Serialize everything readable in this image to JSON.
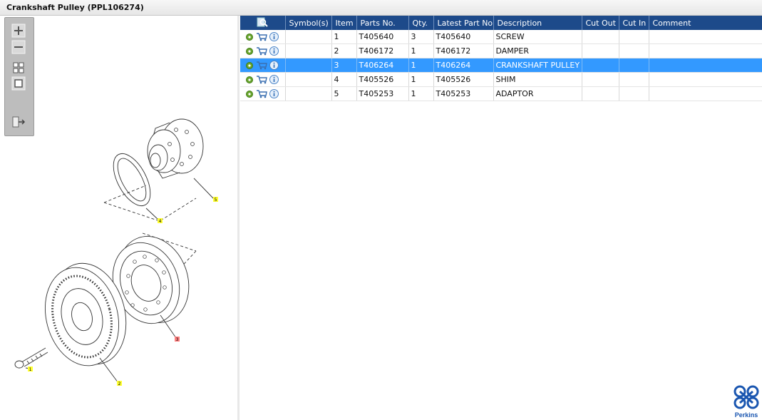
{
  "window": {
    "title": "Crankshaft Pulley (PPL106274)"
  },
  "toolbar": {
    "buttons": [
      {
        "name": "zoom-in-button",
        "icon": "zoom-in-icon"
      },
      {
        "name": "zoom-out-button",
        "icon": "zoom-out-icon"
      },
      {
        "name": "fit-all-button",
        "icon": "fit-all-icon"
      },
      {
        "name": "fit-window-button",
        "icon": "fit-window-icon"
      },
      {
        "name": "export-button",
        "icon": "export-arrow-icon"
      }
    ]
  },
  "diagram": {
    "callouts": [
      "1",
      "2",
      "3",
      "4",
      "5"
    ],
    "highlighted_callout": "3"
  },
  "grid": {
    "header_icon": "magnify-list-icon",
    "columns": [
      "Symbol(s)",
      "Item",
      "Parts No.",
      "Qty.",
      "Latest Part No.",
      "Description",
      "Cut Out",
      "Cut In",
      "Comment"
    ],
    "rows": [
      {
        "item": "1",
        "part_no": "T405640",
        "qty": "3",
        "latest_part_no": "T405640",
        "description": "SCREW",
        "selected": false
      },
      {
        "item": "2",
        "part_no": "T406172",
        "qty": "1",
        "latest_part_no": "T406172",
        "description": "DAMPER",
        "selected": false
      },
      {
        "item": "3",
        "part_no": "T406264",
        "qty": "1",
        "latest_part_no": "T406264",
        "description": "CRANKSHAFT PULLEY",
        "selected": true
      },
      {
        "item": "4",
        "part_no": "T405526",
        "qty": "1",
        "latest_part_no": "T405526",
        "description": "SHIM",
        "selected": false
      },
      {
        "item": "5",
        "part_no": "T405253",
        "qty": "1",
        "latest_part_no": "T405253",
        "description": "ADAPTOR",
        "selected": false
      }
    ],
    "row_icons": [
      "gear-icon",
      "cart-icon",
      "info-icon"
    ]
  },
  "brand": {
    "name": "Perkins",
    "color": "#1a56b0"
  },
  "colors": {
    "header_bg": "#1d4a8a",
    "selected_row": "#3399ff",
    "callout_yellow": "#ffff33",
    "callout_red": "#ff8080"
  }
}
